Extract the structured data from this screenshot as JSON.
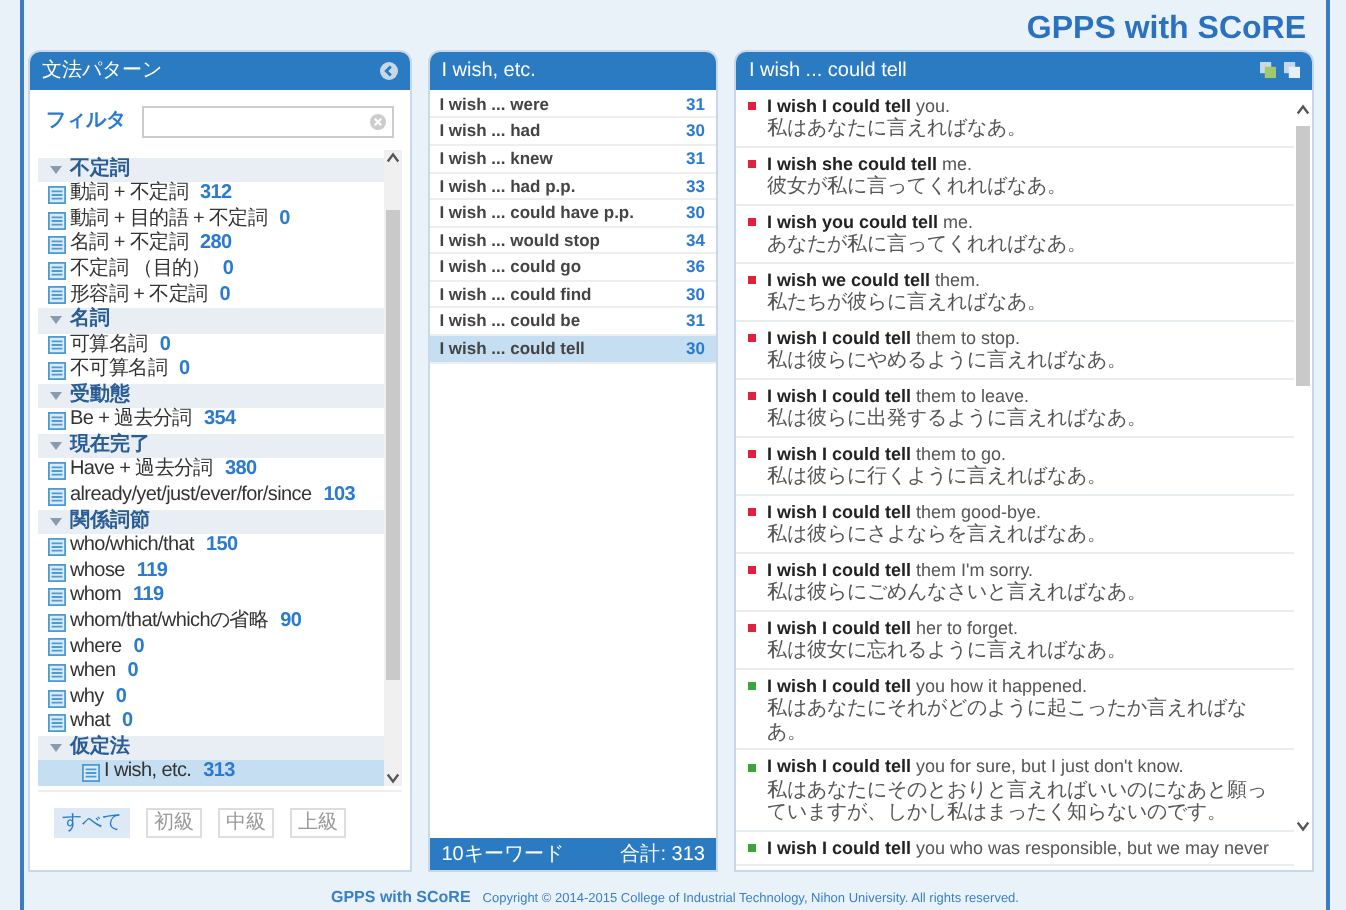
{
  "app_title": "GPPS with SCoRE",
  "pattern_panel": {
    "title": "文法パターン",
    "filter": {
      "label": "フィルタ"
    },
    "groups": [
      {
        "label": "不定詞",
        "expanded": true,
        "children": [
          {
            "label": "動詞 + 不定詞",
            "count": "312",
            "selected": false
          },
          {
            "label": "動詞 + 目的語 + 不定詞",
            "count": "0",
            "selected": false
          },
          {
            "label": "名詞 + 不定詞",
            "count": "280",
            "selected": false
          },
          {
            "label": "不定詞 （目的）",
            "count": "0",
            "selected": false
          },
          {
            "label": "形容詞 + 不定詞",
            "count": "0",
            "selected": false
          }
        ]
      },
      {
        "label": "名詞",
        "expanded": true,
        "children": [
          {
            "label": "可算名詞",
            "count": "0",
            "selected": false
          },
          {
            "label": "不可算名詞",
            "count": "0",
            "selected": false
          }
        ]
      },
      {
        "label": "受動態",
        "expanded": true,
        "children": [
          {
            "label": "Be + 過去分詞",
            "count": "354",
            "selected": false
          }
        ]
      },
      {
        "label": "現在完了",
        "expanded": true,
        "children": [
          {
            "label": "Have + 過去分詞",
            "count": "380",
            "selected": false
          },
          {
            "label": "already/yet/just/ever/for/since",
            "count": "103",
            "selected": false
          }
        ]
      },
      {
        "label": "関係詞節",
        "expanded": true,
        "children": [
          {
            "label": "who/which/that",
            "count": "150",
            "selected": false
          },
          {
            "label": "whose",
            "count": "119",
            "selected": false
          },
          {
            "label": "whom",
            "count": "119",
            "selected": false
          },
          {
            "label": "whom/that/whichの省略",
            "count": "90",
            "selected": false
          },
          {
            "label": "where",
            "count": "0",
            "selected": false
          },
          {
            "label": "when",
            "count": "0",
            "selected": false
          },
          {
            "label": "why",
            "count": "0",
            "selected": false
          },
          {
            "label": "what",
            "count": "0",
            "selected": false
          }
        ]
      },
      {
        "label": "仮定法",
        "expanded": true,
        "children": [
          {
            "label": "I wish, etc.",
            "count": "313",
            "selected": true
          }
        ]
      }
    ],
    "levels": [
      {
        "label": "すべて",
        "selected": true
      },
      {
        "label": "初級",
        "selected": false
      },
      {
        "label": "中級",
        "selected": false
      },
      {
        "label": "上級",
        "selected": false
      }
    ]
  },
  "keyword_panel": {
    "title": "I wish, etc.",
    "rows": [
      {
        "label": "I wish ... were",
        "count": "31",
        "selected": false
      },
      {
        "label": "I wish ... had",
        "count": "30",
        "selected": false
      },
      {
        "label": "I wish ... knew",
        "count": "31",
        "selected": false
      },
      {
        "label": "I wish ... had p.p.",
        "count": "33",
        "selected": false
      },
      {
        "label": "I wish ... could have p.p.",
        "count": "30",
        "selected": false
      },
      {
        "label": "I wish ... would stop",
        "count": "34",
        "selected": false
      },
      {
        "label": "I wish ... could go",
        "count": "36",
        "selected": false
      },
      {
        "label": "I wish ... could find",
        "count": "30",
        "selected": false
      },
      {
        "label": "I wish ... could be",
        "count": "31",
        "selected": false
      },
      {
        "label": "I wish ... could tell",
        "count": "30",
        "selected": true
      }
    ],
    "footer_count": "10キーワード",
    "footer_total": "合計: 313"
  },
  "example_panel": {
    "title": "I wish ... could tell",
    "examples": [
      {
        "text": "**I wish I could tell** you.",
        "translation": "私はあなたに言えればなあ。",
        "color": "#e0203c"
      },
      {
        "text": "**I wish she could tell** me.",
        "translation": "彼女が私に言ってくれればなあ。",
        "color": "#e0203c"
      },
      {
        "text": "**I wish you could tell** me.",
        "translation": "あなたが私に言ってくれればなあ。",
        "color": "#e0203c"
      },
      {
        "text": "**I wish we could tell** them.",
        "translation": "私たちが彼らに言えればなあ。",
        "color": "#e0203c"
      },
      {
        "text": "**I wish I could tell** them to stop.",
        "translation": "私は彼らにやめるように言えればなあ。",
        "color": "#e0203c"
      },
      {
        "text": "**I wish I could tell** them to leave.",
        "translation": "私は彼らに出発するように言えればなあ。",
        "color": "#e0203c"
      },
      {
        "text": "**I wish I could tell** them to go.",
        "translation": "私は彼らに行くように言えればなあ。",
        "color": "#e0203c"
      },
      {
        "text": "**I wish I could tell** them good-bye.",
        "translation": "私は彼らにさよならを言えればなあ。",
        "color": "#e0203c"
      },
      {
        "text": "**I wish I could tell** them I'm sorry.",
        "translation": "私は彼らにごめんなさいと言えればなあ。",
        "color": "#e0203c"
      },
      {
        "text": "**I wish I could tell** her to forget.",
        "translation": "私は彼女に忘れるように言えればなあ。",
        "color": "#e0203c"
      },
      {
        "text": "**I wish I could tell** you how it happened.",
        "translation": "私はあなたにそれがどのように起こったか言えればなあ。",
        "color": "#3aa53a"
      },
      {
        "text": "**I wish I could tell** you for sure, but I just don't know.",
        "translation": "私はあなたにそのとおりと言えればいいのになあと願っていますが、しかし私はまったく知らないのです。",
        "color": "#3aa53a"
      },
      {
        "text": "**I wish I could tell** you who was responsible, but we may never",
        "color": "#3aa53a"
      }
    ]
  },
  "footer": {
    "brand": "GPPS with SCoRE",
    "copyright": "Copyright © 2014-2015 College of Industrial Technology, Nihon University. All rights reserved."
  }
}
